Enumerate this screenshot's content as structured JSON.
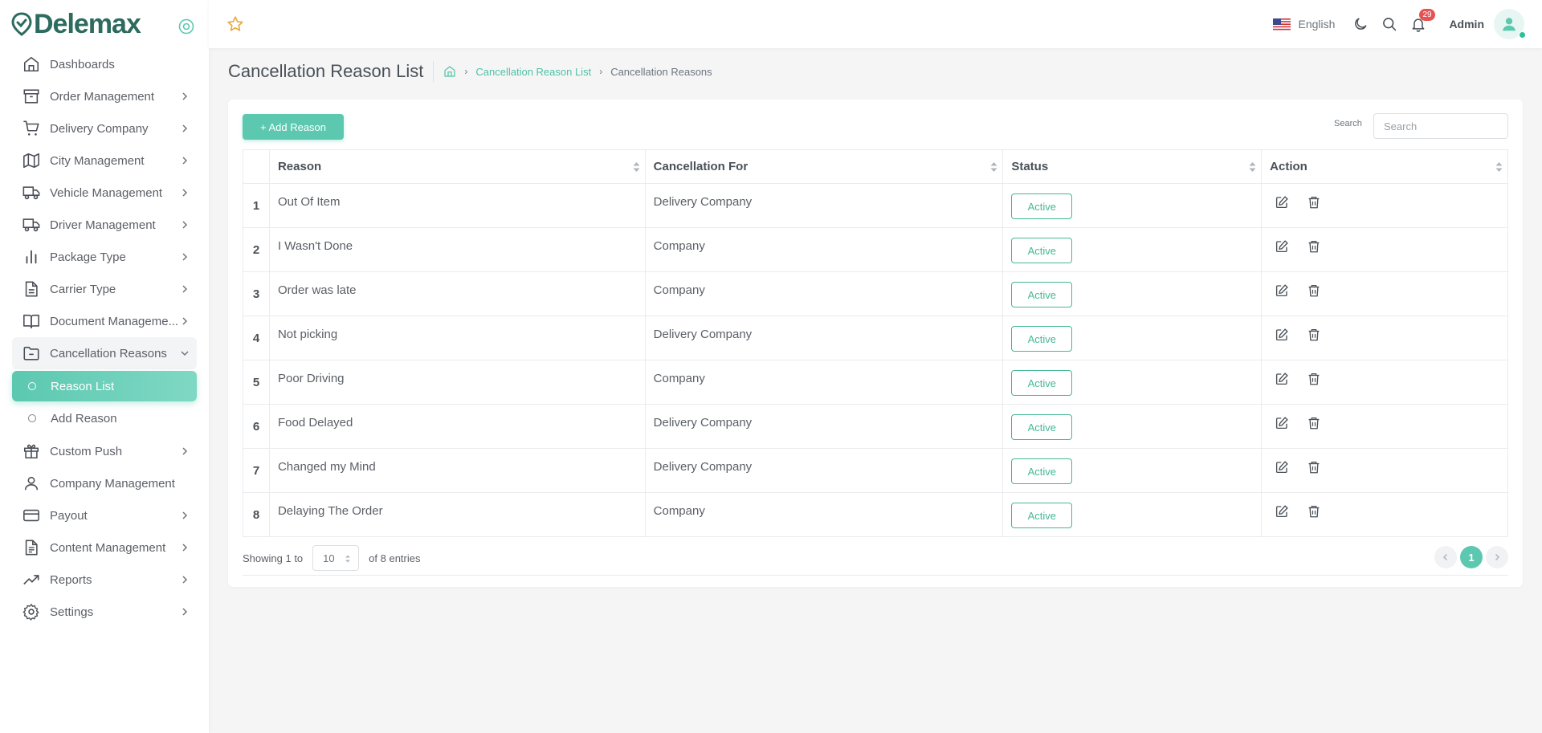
{
  "brand": {
    "name": "Delemax",
    "color": "#2e6b5f",
    "accent": "#5cc8b0"
  },
  "sidebar": {
    "items": [
      {
        "label": "Dashboards",
        "icon": "home-icon",
        "has_chevron": false
      },
      {
        "label": "Order Management",
        "icon": "archive-icon",
        "has_chevron": true
      },
      {
        "label": "Delivery Company",
        "icon": "cart-icon",
        "has_chevron": true
      },
      {
        "label": "City Management",
        "icon": "map-icon",
        "has_chevron": true
      },
      {
        "label": "Vehicle Management",
        "icon": "truck-icon",
        "has_chevron": true
      },
      {
        "label": "Driver Management",
        "icon": "truck-icon",
        "has_chevron": true
      },
      {
        "label": "Package Type",
        "icon": "bar-chart-icon",
        "has_chevron": true
      },
      {
        "label": "Carrier Type",
        "icon": "file-icon",
        "has_chevron": true
      },
      {
        "label": "Document Manageme...",
        "icon": "book-icon",
        "has_chevron": true
      },
      {
        "label": "Cancellation Reasons",
        "icon": "folder-minus-icon",
        "has_chevron": true,
        "open": true
      }
    ],
    "subitems": [
      {
        "label": "Reason List",
        "active": true
      },
      {
        "label": "Add Reason",
        "active": false
      }
    ],
    "items_after": [
      {
        "label": "Custom Push",
        "icon": "gift-icon",
        "has_chevron": true
      },
      {
        "label": "Company Management",
        "icon": "user-icon",
        "has_chevron": false
      },
      {
        "label": "Payout",
        "icon": "credit-card-icon",
        "has_chevron": true
      },
      {
        "label": "Content Management",
        "icon": "file-text-icon",
        "has_chevron": true
      },
      {
        "label": "Reports",
        "icon": "trending-up-icon",
        "has_chevron": true
      },
      {
        "label": "Settings",
        "icon": "settings-icon",
        "has_chevron": true
      }
    ]
  },
  "header": {
    "language": "English",
    "notification_count": "29",
    "user_name": "Admin"
  },
  "page": {
    "title": "Cancellation Reason List",
    "breadcrumb": {
      "link": "Cancellation Reason List",
      "current": "Cancellation Reasons"
    }
  },
  "toolbar": {
    "add_label": "+ Add Reason",
    "search_label": "Search",
    "search_placeholder": "Search",
    "search_value": ""
  },
  "table": {
    "columns": [
      "",
      "Reason",
      "Cancellation For",
      "Status",
      "Action"
    ],
    "rows": [
      {
        "index": "1",
        "reason": "Out Of Item",
        "for": "Delivery Company",
        "status": "Active"
      },
      {
        "index": "2",
        "reason": "I Wasn't Done",
        "for": "Company",
        "status": "Active"
      },
      {
        "index": "3",
        "reason": "Order was late",
        "for": "Company",
        "status": "Active"
      },
      {
        "index": "4",
        "reason": "Not picking",
        "for": "Delivery Company",
        "status": "Active"
      },
      {
        "index": "5",
        "reason": "Poor Driving",
        "for": "Company",
        "status": "Active"
      },
      {
        "index": "6",
        "reason": "Food Delayed",
        "for": "Delivery Company",
        "status": "Active"
      },
      {
        "index": "7",
        "reason": "Changed my Mind",
        "for": "Delivery Company",
        "status": "Active"
      },
      {
        "index": "8",
        "reason": "Delaying The Order",
        "for": "Company",
        "status": "Active"
      }
    ]
  },
  "footer": {
    "showing_prefix": "Showing 1 to",
    "page_length": "10",
    "showing_suffix": "of 8 entries",
    "current_page": "1"
  }
}
